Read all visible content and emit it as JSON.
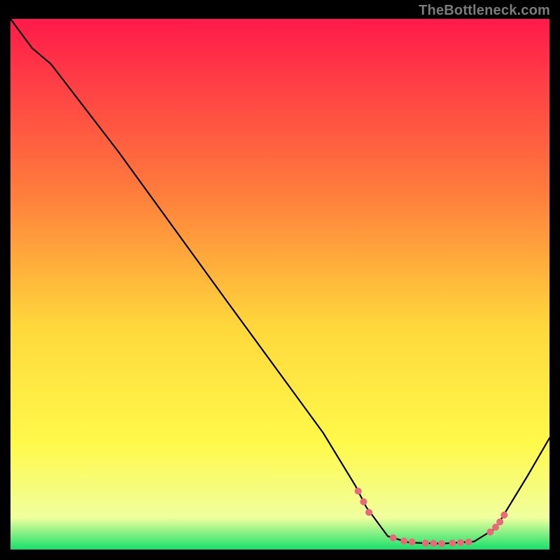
{
  "attribution": "TheBottleneck.com",
  "chart_data": {
    "type": "line",
    "title": "",
    "xlabel": "",
    "ylabel": "",
    "xlim": [
      0,
      100
    ],
    "ylim": [
      0,
      100
    ],
    "grid": false,
    "legend": false,
    "background_gradient": {
      "top": "#ff1a4b",
      "mid_upper": "#ff7a3c",
      "mid": "#ffd83c",
      "mid_lower": "#fff94a",
      "near_bottom": "#f0ff9e",
      "bottom": "#17e06a"
    },
    "curve": {
      "description": "monotone descent from top-left with a slight kink, reaching a flat valley near x≈68–90, then rising toward the right edge",
      "points": [
        {
          "x": 0,
          "y": 100
        },
        {
          "x": 4,
          "y": 94.5
        },
        {
          "x": 7.5,
          "y": 91.5
        },
        {
          "x": 20,
          "y": 75
        },
        {
          "x": 40,
          "y": 47
        },
        {
          "x": 58,
          "y": 22
        },
        {
          "x": 64,
          "y": 12
        },
        {
          "x": 66,
          "y": 8
        },
        {
          "x": 70,
          "y": 2.5
        },
        {
          "x": 74,
          "y": 1.3
        },
        {
          "x": 80,
          "y": 1.1
        },
        {
          "x": 86,
          "y": 1.5
        },
        {
          "x": 90,
          "y": 4
        },
        {
          "x": 96,
          "y": 14
        },
        {
          "x": 100,
          "y": 21
        }
      ]
    },
    "markers": {
      "color": "#e86a78",
      "radius_px": 5,
      "points": [
        {
          "x": 64.5,
          "y": 11
        },
        {
          "x": 65.5,
          "y": 9
        },
        {
          "x": 66.5,
          "y": 7
        },
        {
          "x": 71,
          "y": 2.2
        },
        {
          "x": 73,
          "y": 1.6
        },
        {
          "x": 74.5,
          "y": 1.4
        },
        {
          "x": 77,
          "y": 1.2
        },
        {
          "x": 78.5,
          "y": 1.15
        },
        {
          "x": 80,
          "y": 1.1
        },
        {
          "x": 82,
          "y": 1.2
        },
        {
          "x": 83.5,
          "y": 1.3
        },
        {
          "x": 85,
          "y": 1.4
        },
        {
          "x": 89,
          "y": 3.3
        },
        {
          "x": 90,
          "y": 4.2
        },
        {
          "x": 90.8,
          "y": 5.2
        },
        {
          "x": 91.6,
          "y": 6.5
        }
      ]
    }
  }
}
